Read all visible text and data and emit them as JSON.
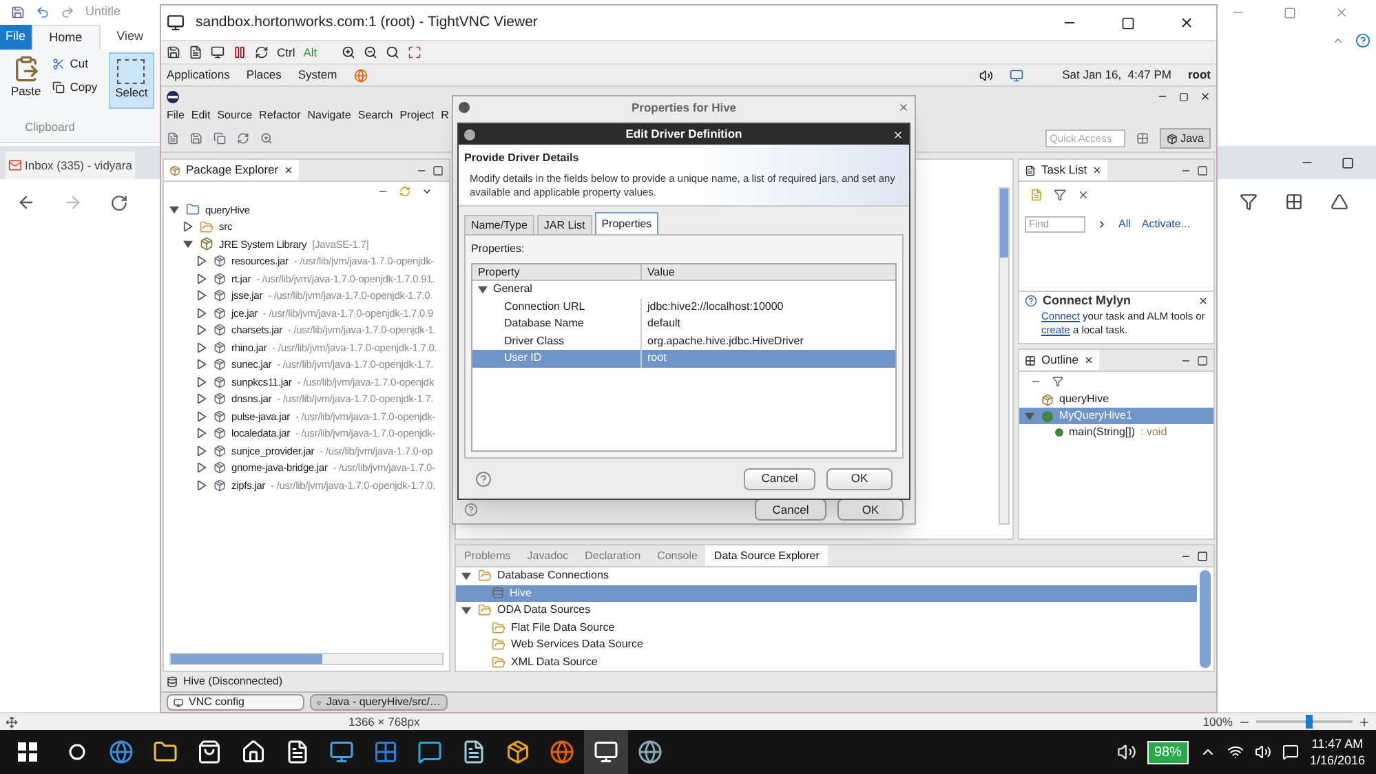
{
  "paint": {
    "title": "Untitle",
    "file_menu": "File",
    "tabs": [
      {
        "label": "Home",
        "selected": true
      },
      {
        "label": "View",
        "selected": false
      }
    ],
    "paste": "Paste",
    "cut": "Cut",
    "copy": "Copy",
    "select": "Select",
    "group": "Clipboard",
    "canvas_size": "1366 × 768px",
    "zoom": "100%",
    "zoom_slider": {
      "level": 0.55
    }
  },
  "browser_tab": "Inbox (335) - vidyara",
  "vnc": {
    "title": "sandbox.hortonworks.com:1 (root) - TightVNC Viewer",
    "keys": [
      "Ctrl",
      "Alt"
    ],
    "panel_menus": [
      "Applications",
      "Places",
      "System"
    ],
    "clock": "Sat Jan 16,  4:47 PM",
    "user": "root",
    "windows": [
      {
        "label": "VNC config",
        "selected": false
      },
      {
        "label": "Java - queryHive/src/…",
        "selected": true
      }
    ]
  },
  "eclipse": {
    "menus": [
      "File",
      "Edit",
      "Source",
      "Refactor",
      "Navigate",
      "Search",
      "Project",
      "R"
    ],
    "quick_access": {
      "placeholder": "Quick Access"
    },
    "perspective": "Java",
    "package_explorer": {
      "title": "Package Explorer",
      "tree": [
        {
          "kind": "project",
          "label": "queryHive",
          "expanded": true,
          "children": [
            {
              "kind": "folder",
              "label": "src",
              "expanded": false
            },
            {
              "kind": "library",
              "label": "JRE System Library",
              "note": "[JavaSE-1.7]",
              "expanded": true,
              "children": [
                {
                  "kind": "jar",
                  "label": "resources.jar",
                  "note": "- /usr/lib/jvm/java-1.7.0-openjdk-",
                  "expanded": false
                },
                {
                  "kind": "jar",
                  "label": "rt.jar",
                  "note": "- /usr/lib/jvm/java-1.7.0-openjdk-1.7.0.91.",
                  "expanded": false
                },
                {
                  "kind": "jar",
                  "label": "jsse.jar",
                  "note": "- /usr/lib/jvm/java-1.7.0-openjdk-1.7.0.",
                  "expanded": false
                },
                {
                  "kind": "jar",
                  "label": "jce.jar",
                  "note": "- /usr/lib/jvm/java-1.7.0-openjdk-1.7.0.9",
                  "expanded": false
                },
                {
                  "kind": "jar",
                  "label": "charsets.jar",
                  "note": "- /usr/lib/jvm/java-1.7.0-openjdk-1.",
                  "expanded": false
                },
                {
                  "kind": "jar",
                  "label": "rhino.jar",
                  "note": "- /usr/lib/jvm/java-1.7.0-openjdk-1.7.0.",
                  "expanded": false
                },
                {
                  "kind": "jar",
                  "label": "sunec.jar",
                  "note": "- /usr/lib/jvm/java-1.7.0-openjdk-1.7.",
                  "expanded": false
                },
                {
                  "kind": "jar",
                  "label": "sunpkcs11.jar",
                  "note": "- /usr/lib/jvm/java-1.7.0-openjdk",
                  "expanded": false
                },
                {
                  "kind": "jar",
                  "label": "dnsns.jar",
                  "note": "- /usr/lib/jvm/java-1.7.0-openjdk-1.7.",
                  "expanded": false
                },
                {
                  "kind": "jar",
                  "label": "pulse-java.jar",
                  "note": "- /usr/lib/jvm/java-1.7.0-openjdk-",
                  "expanded": false
                },
                {
                  "kind": "jar",
                  "label": "localedata.jar",
                  "note": "- /usr/lib/jvm/java-1.7.0-openjdk-",
                  "expanded": false
                },
                {
                  "kind": "jar",
                  "label": "sunjce_provider.jar",
                  "note": "- /usr/lib/jvm/java-1.7.0-op",
                  "expanded": false
                },
                {
                  "kind": "jar",
                  "label": "gnome-java-bridge.jar",
                  "note": "- /usr/lib/jvm/java-1.7.0-",
                  "expanded": false
                },
                {
                  "kind": "jar",
                  "label": "zipfs.jar",
                  "note": "- /usr/lib/jvm/java-1.7.0-openjdk-1.7.0.",
                  "expanded": false
                }
              ]
            }
          ]
        }
      ]
    },
    "task_list": {
      "title": "Task List",
      "find": {
        "placeholder": "Find"
      },
      "all": "All",
      "activate": "Activate..."
    },
    "mylyn": {
      "title": "Connect Mylyn",
      "link1": "Connect",
      "text1": " your task and ALM tools or ",
      "link2": "create",
      "text2": " a local task."
    },
    "outline": {
      "title": "Outline",
      "tree": [
        {
          "kind": "package",
          "label": "queryHive",
          "selected": false
        },
        {
          "kind": "class",
          "label": "MyQueryHive1",
          "selected": true,
          "expanded": true,
          "children": [
            {
              "kind": "method",
              "label": "main(String[])",
              "note": ": void",
              "selected": false
            }
          ]
        }
      ]
    },
    "bottom_tabs": [
      {
        "label": "Problems",
        "selected": false
      },
      {
        "label": "Javadoc",
        "selected": false
      },
      {
        "label": "Declaration",
        "selected": false
      },
      {
        "label": "Console",
        "selected": false
      },
      {
        "label": "Data Source Explorer",
        "selected": true
      }
    ],
    "data_sources": [
      {
        "kind": "folder",
        "label": "Database Connections",
        "expanded": true,
        "selected": false,
        "children": [
          {
            "kind": "connection",
            "label": "Hive",
            "selected": true
          }
        ]
      },
      {
        "kind": "folder",
        "label": "ODA Data Sources",
        "expanded": true,
        "selected": false,
        "children": [
          {
            "kind": "folder",
            "label": "Flat File Data Source",
            "selected": false
          },
          {
            "kind": "folder",
            "label": "Web Services Data Source",
            "selected": false
          },
          {
            "kind": "folder",
            "label": "XML Data Source",
            "selected": false
          }
        ]
      }
    ],
    "status": "Hive (Disconnected)"
  },
  "properties_dialog": {
    "title": "Properties for Hive",
    "buttons": [
      "Cancel",
      "OK"
    ]
  },
  "driver_dialog": {
    "title": "Edit Driver Definition",
    "heading": "Provide Driver Details",
    "description": "Modify details in the fields below to provide a unique name, a list of required jars, and set any available and applicable property values.",
    "tabs": [
      {
        "label": "Name/Type",
        "selected": false
      },
      {
        "label": "JAR List",
        "selected": false
      },
      {
        "label": "Properties",
        "selected": true
      }
    ],
    "section": "Properties:",
    "columns": [
      "Property",
      "Value"
    ],
    "group": {
      "label": "General",
      "expanded": true
    },
    "rows": [
      {
        "property": "Connection URL",
        "value": "jdbc:hive2://localhost:10000",
        "selected": false
      },
      {
        "property": "Database Name",
        "value": "default",
        "selected": false
      },
      {
        "property": "Driver Class",
        "value": "org.apache.hive.jdbc.HiveDriver",
        "selected": false
      },
      {
        "property": "User ID",
        "value": "root",
        "selected": true
      }
    ],
    "buttons": [
      "Cancel",
      "OK"
    ]
  },
  "taskbar": {
    "battery": "98%",
    "time": "11:47 AM",
    "date": "1/16/2016"
  }
}
